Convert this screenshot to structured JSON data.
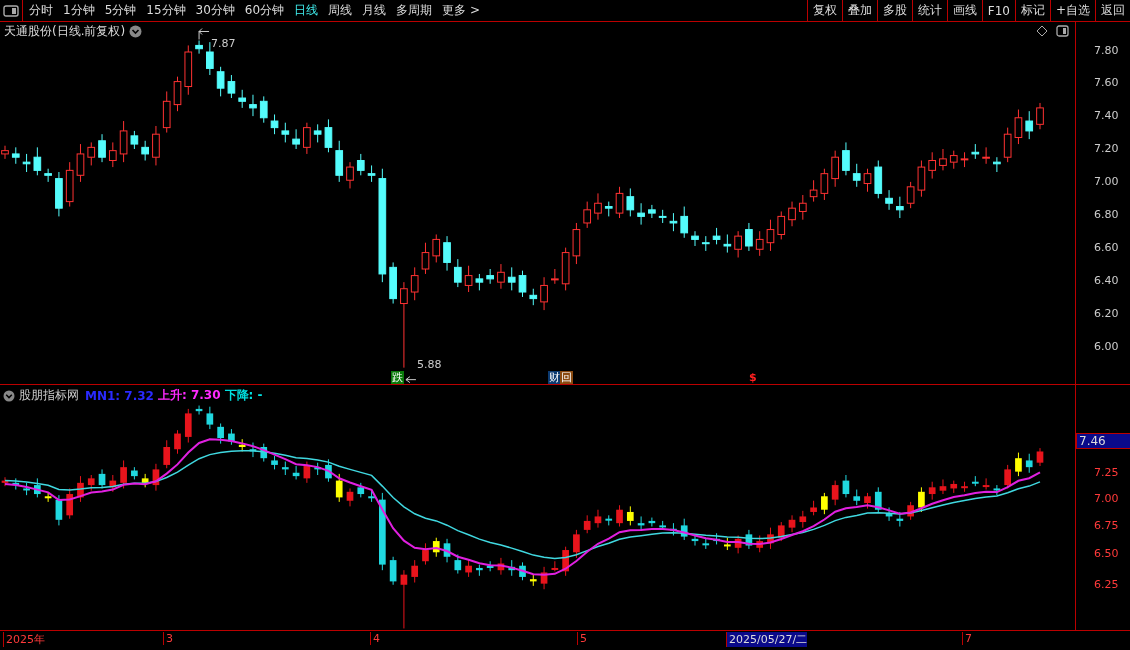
{
  "toolbar": {
    "periods": [
      {
        "label": "分时",
        "selected": false
      },
      {
        "label": "1分钟",
        "selected": false
      },
      {
        "label": "5分钟",
        "selected": false
      },
      {
        "label": "15分钟",
        "selected": false
      },
      {
        "label": "30分钟",
        "selected": false
      },
      {
        "label": "60分钟",
        "selected": false
      },
      {
        "label": "日线",
        "selected": true
      },
      {
        "label": "周线",
        "selected": false
      },
      {
        "label": "月线",
        "selected": false
      },
      {
        "label": "多周期",
        "selected": false
      },
      {
        "label": "更多 >",
        "selected": false
      }
    ],
    "actions": [
      "复权",
      "叠加",
      "多股",
      "统计",
      "画线",
      "F10",
      "标记",
      "+自选",
      "返回"
    ]
  },
  "main_chart": {
    "title": "天通股份(日线.前复权)",
    "y_ticks": [
      "7.80",
      "7.60",
      "7.40",
      "7.20",
      "7.00",
      "6.80",
      "6.60",
      "6.40",
      "6.20",
      "6.00"
    ],
    "high_label": "7.87",
    "low_label": "5.88",
    "markers": [
      {
        "kind": "fall",
        "text": "跌"
      },
      {
        "kind": "finance",
        "text": "财"
      },
      {
        "kind": "review",
        "text": "回"
      },
      {
        "kind": "dollar",
        "text": "$"
      }
    ]
  },
  "indicator": {
    "name": "股朋指标网",
    "legend": [
      {
        "text": "MN1: 7.32",
        "color": "#2a2aff"
      },
      {
        "text": "上升: 7.30",
        "color": "#ff2aff"
      },
      {
        "text": "下降: -",
        "color": "#00e0e0"
      }
    ],
    "current_value": "7.46",
    "y_ticks": [
      "7.25",
      "7.00",
      "6.75",
      "6.50",
      "6.25"
    ]
  },
  "date_axis": [
    {
      "label": "2025年",
      "selected": false
    },
    {
      "label": "3",
      "selected": false
    },
    {
      "label": "4",
      "selected": false
    },
    {
      "label": "5",
      "selected": false
    },
    {
      "label": "2025/05/27/二",
      "selected": true
    },
    {
      "label": "7",
      "selected": false
    }
  ]
}
